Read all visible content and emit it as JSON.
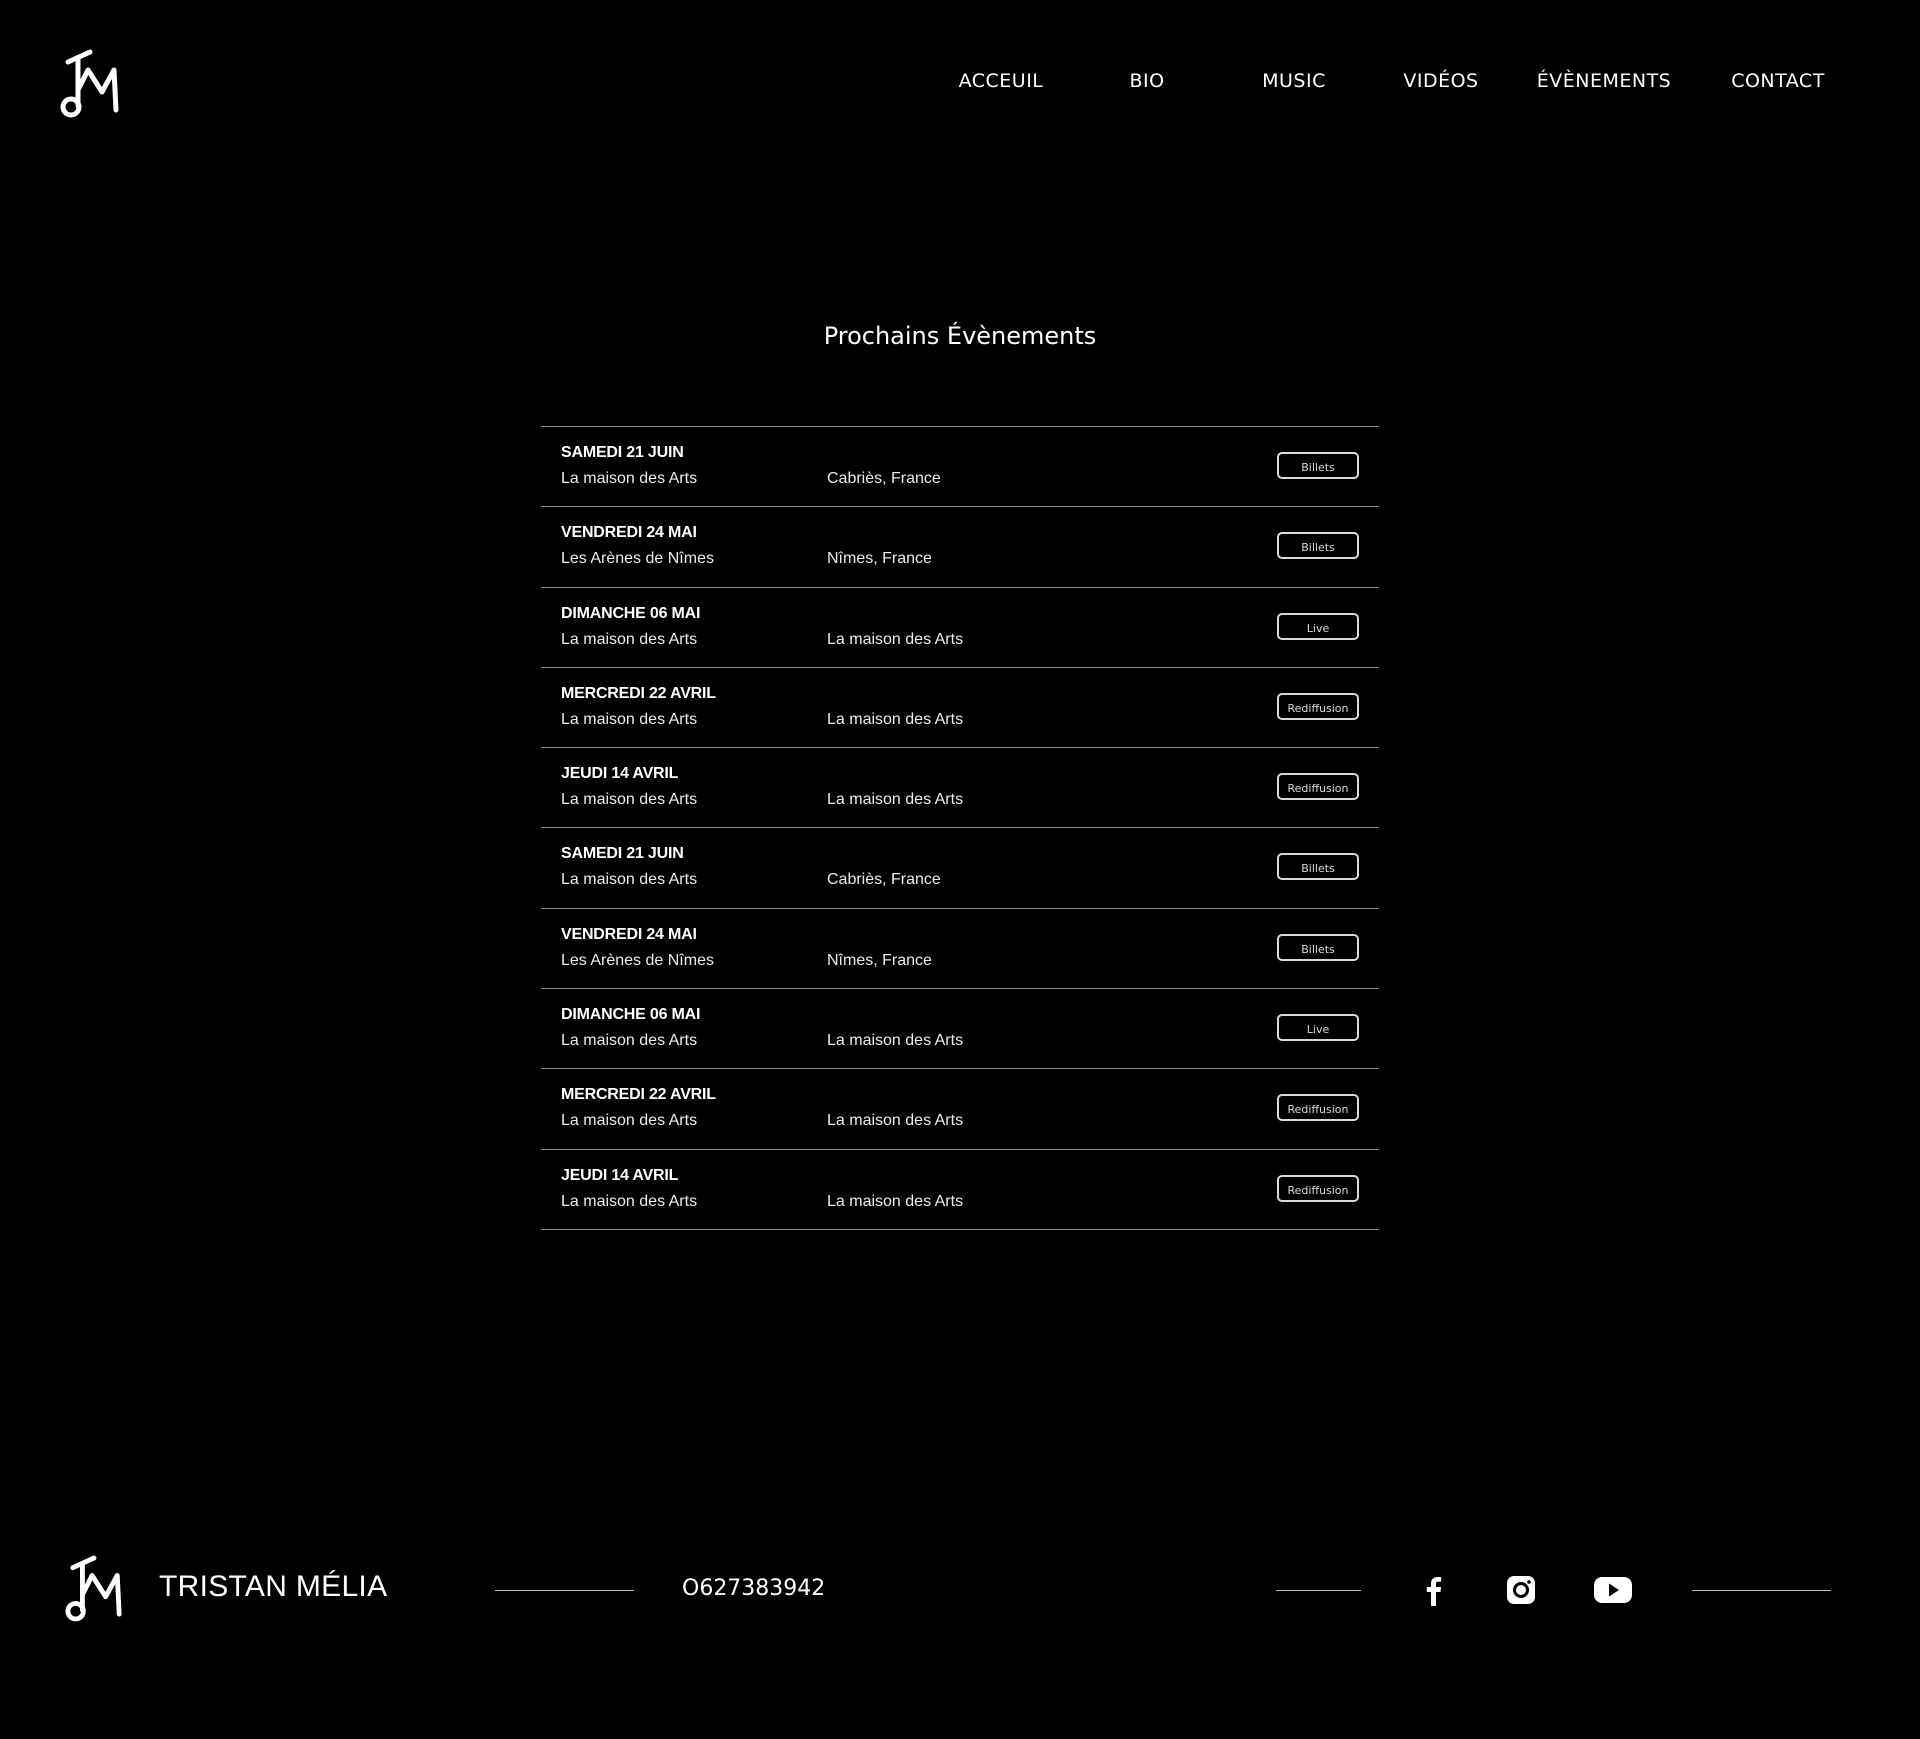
{
  "header": {
    "logo": "jm-monogram-logo",
    "nav": [
      {
        "label": "ACCEUIL"
      },
      {
        "label": "BIO"
      },
      {
        "label": "MUSIC"
      },
      {
        "label": "VIDÉOS"
      },
      {
        "label": "ÉVÈNEMENTS"
      },
      {
        "label": "CONTACT"
      }
    ]
  },
  "main": {
    "title": "Prochains Évènements",
    "events": [
      {
        "date": "SAMEDI 21 JUIN",
        "venue": "La maison des Arts",
        "location": "Cabriès, France",
        "action": "Billets"
      },
      {
        "date": "VENDREDI 24 MAI",
        "venue": "Les Arènes de Nîmes",
        "location": "Nîmes, France",
        "action": "Billets"
      },
      {
        "date": "DIMANCHE 06 MAI",
        "venue": "La maison des Arts",
        "location": "La maison des Arts",
        "action": "Live"
      },
      {
        "date": "MERCREDI 22 AVRIL",
        "venue": "La maison des Arts",
        "location": "La maison des Arts",
        "action": "Rediffusion"
      },
      {
        "date": "JEUDI 14 AVRIL",
        "venue": "La maison des Arts",
        "location": "La maison des Arts",
        "action": "Rediffusion"
      },
      {
        "date": "SAMEDI 21 JUIN",
        "venue": "La maison des Arts",
        "location": "Cabriès, France",
        "action": "Billets"
      },
      {
        "date": "VENDREDI 24 MAI",
        "venue": "Les Arènes de Nîmes",
        "location": "Nîmes, France",
        "action": "Billets"
      },
      {
        "date": "DIMANCHE 06 MAI",
        "venue": "La maison des Arts",
        "location": "La maison des Arts",
        "action": "Live"
      },
      {
        "date": "MERCREDI 22 AVRIL",
        "venue": "La maison des Arts",
        "location": "La maison des Arts",
        "action": "Rediffusion"
      },
      {
        "date": "JEUDI 14 AVRIL",
        "venue": "La maison des Arts",
        "location": "La maison des Arts",
        "action": "Rediffusion"
      }
    ]
  },
  "footer": {
    "name": "TRISTAN MÉLIA",
    "phone": "O627383942",
    "social": [
      {
        "icon": "facebook-icon"
      },
      {
        "icon": "instagram-icon"
      },
      {
        "icon": "youtube-icon"
      }
    ]
  },
  "colors": {
    "background": "#000000",
    "text": "#ffffff",
    "divider": "#8a8a8a",
    "button_border": "#d9d9d9"
  }
}
